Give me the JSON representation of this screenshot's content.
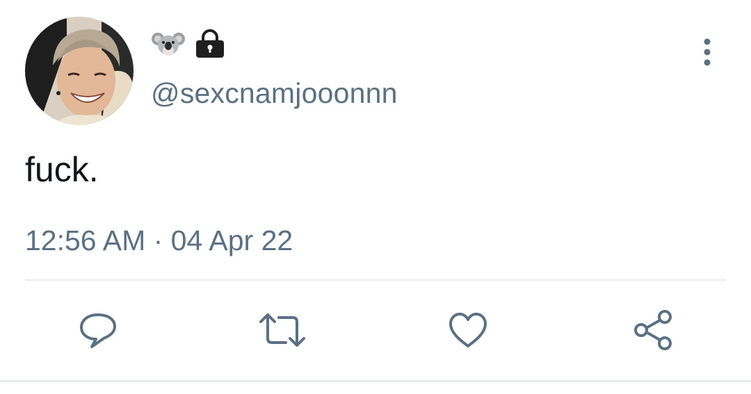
{
  "tweet": {
    "display_name_icons": [
      "koala-icon",
      "lock-icon"
    ],
    "handle": "@sexcnamjooonnn",
    "text": "fuck.",
    "timestamp": "12:56 AM · 04 Apr 22"
  },
  "actions": [
    "reply-icon",
    "retweet-icon",
    "like-icon",
    "share-icon"
  ],
  "colors": {
    "text_primary": "#14171a",
    "text_secondary": "#5b7083",
    "divider": "#e6ecf0",
    "icon": "#5b7083"
  }
}
